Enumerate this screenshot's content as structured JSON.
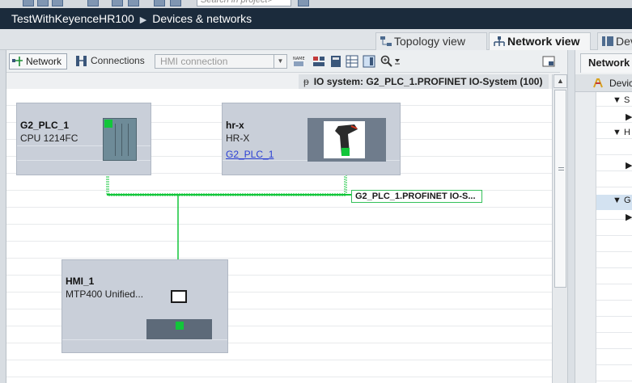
{
  "toolbar_top": {
    "search_placeholder": "Search in project>"
  },
  "title_bar": {
    "project": "TestWithKeyenceHR100",
    "separator": "▶",
    "section": "Devices & networks"
  },
  "view_tabs": [
    {
      "label": "Topology view",
      "active": false
    },
    {
      "label": "Network view",
      "active": true
    },
    {
      "label": "Device view",
      "active": false
    }
  ],
  "editor_toolbar": {
    "network_label": "Network",
    "connections_label": "Connections",
    "connection_type": "HMI connection"
  },
  "io_system_banner": {
    "pin_glyph": "ᵽ",
    "text": "IO system: G2_PLC_1.PROFINET IO-System (100)"
  },
  "devices": {
    "plc": {
      "name": "G2_PLC_1",
      "type": "CPU 1214FC"
    },
    "scanner": {
      "name": "hr-x",
      "type": "HR-X",
      "assigned_to": "G2_PLC_1"
    },
    "hmi": {
      "name": "HMI_1",
      "type": "MTP400 Unified..."
    }
  },
  "network_label": "G2_PLC_1.PROFINET IO-S...",
  "overview_panel": {
    "tab": "Network overview",
    "column_header": "Device",
    "rows": [
      {
        "indent": 1,
        "prefix": "▼",
        "text": "S"
      },
      {
        "indent": 2,
        "prefix": "▶",
        "text": ""
      },
      {
        "indent": 1,
        "prefix": "▼",
        "text": "H"
      },
      {
        "indent": 2,
        "prefix": "",
        "text": ""
      },
      {
        "indent": 2,
        "prefix": "▶",
        "text": ""
      },
      {
        "indent": 1,
        "prefix": "▼",
        "text": "G"
      },
      {
        "indent": 2,
        "prefix": "▶",
        "text": ""
      }
    ]
  },
  "colors": {
    "title_bar": "#1b2b3c",
    "device_box": "#c9cfd9",
    "link_green": "#12c63a",
    "hyperlink": "#2a3fd4"
  }
}
